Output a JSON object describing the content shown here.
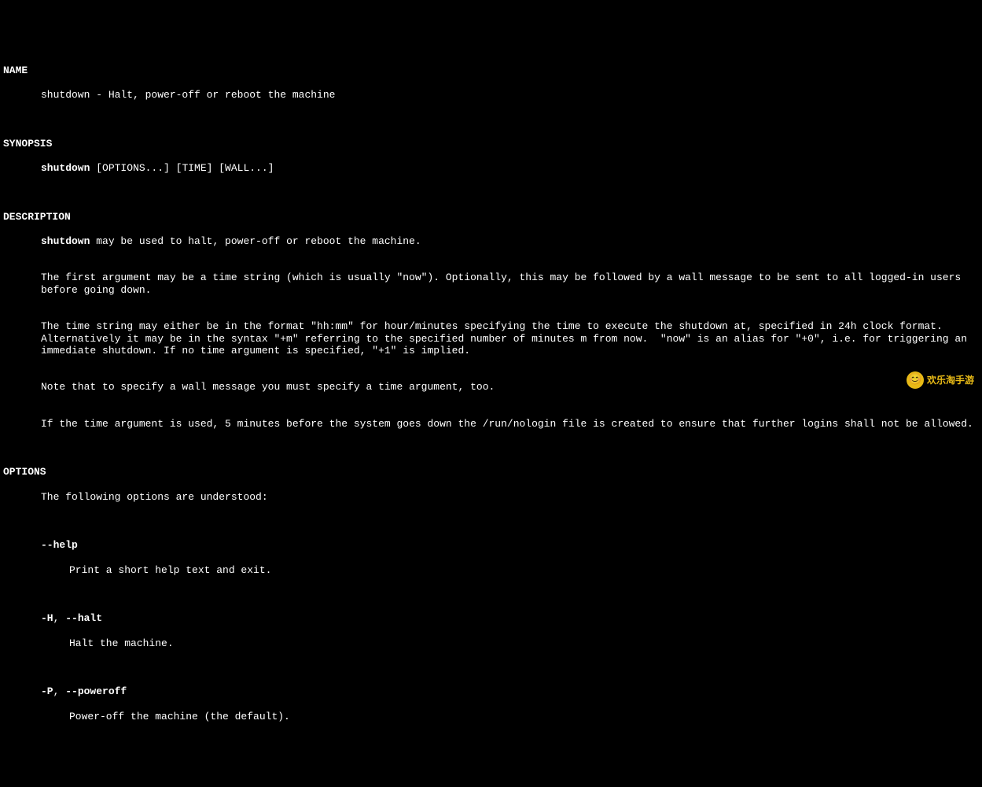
{
  "sections": {
    "name": {
      "header": "NAME",
      "body": "shutdown - Halt, power-off or reboot the machine"
    },
    "synopsis": {
      "header": "SYNOPSIS",
      "cmd": "shutdown",
      "args": " [OPTIONS...] [TIME] [WALL...]"
    },
    "description": {
      "header": "DESCRIPTION",
      "cmd": "shutdown",
      "intro": " may be used to halt, power-off or reboot the machine.",
      "para1": "The first argument may be a time string (which is usually \"now\"). Optionally, this may be followed by a wall message to be sent to all logged-in users before going down.",
      "para2": "The time string may either be in the format \"hh:mm\" for hour/minutes specifying the time to execute the shutdown at, specified in 24h clock format. Alternatively it may be in the syntax \"+m\" referring to the specified number of minutes m from now.  \"now\" is an alias for \"+0\", i.e. for triggering an immediate shutdown. If no time argument is specified, \"+1\" is implied.",
      "para3": "Note that to specify a wall message you must specify a time argument, too.",
      "para4": "If the time argument is used, 5 minutes before the system goes down the /run/nologin file is created to ensure that further logins shall not be allowed."
    },
    "options": {
      "header": "OPTIONS",
      "intro": "The following options are understood:",
      "items": [
        {
          "flags": "--help",
          "sep": "",
          "flags2": "",
          "desc": "Print a short help text and exit."
        },
        {
          "flags": "-H",
          "sep": ", ",
          "flags2": "--halt",
          "desc": "Halt the machine."
        },
        {
          "flags": "-P",
          "sep": ", ",
          "flags2": "--poweroff",
          "desc": "Power-off the machine (the default)."
        }
      ]
    }
  },
  "watermark": {
    "text": "欢乐淘手游",
    "icon": "😊"
  }
}
